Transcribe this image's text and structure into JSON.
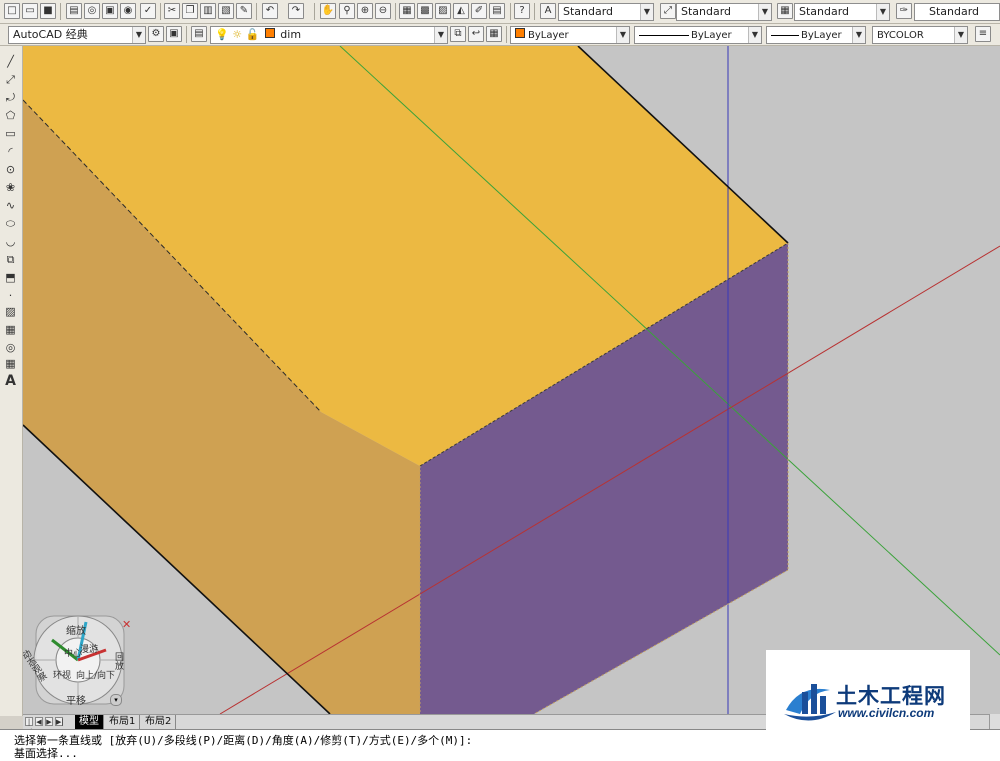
{
  "colors": {
    "top_face": "#ecb942",
    "left_face": "#cfa152",
    "front_face": "#745a8f",
    "viewport_bg": "#c5c5c5",
    "layer_swatch": "#ff7f00"
  },
  "toolbar_top": {
    "text_style": "Standard",
    "dim_style": "Standard",
    "table_style": "Standard",
    "multileader_style": "Standard"
  },
  "toolbar_props": {
    "workspace": "AutoCAD 经典",
    "layer": "dim",
    "color": "ByLayer",
    "linetype": "ByLayer",
    "lineweight": "ByLayer",
    "plotstyle": "BYCOLOR"
  },
  "left_tools": [
    "line-icon",
    "construction-line-icon",
    "polyline-icon",
    "polygon-icon",
    "rectangle-icon",
    "arc-icon",
    "circle-icon",
    "revision-cloud-icon",
    "spline-icon",
    "ellipse-icon",
    "ellipse-arc-icon",
    "insert-block-icon",
    "make-block-icon",
    "point-icon",
    "hatch-icon",
    "gradient-icon",
    "region-icon",
    "table-icon",
    "multiline-text-icon"
  ],
  "steering_wheel": {
    "zoom": "缩放",
    "orbit": "动态观察",
    "rewind": "回放",
    "pan": "平移",
    "center": "中心",
    "walk": "漫游",
    "lookup": "向上/向下",
    "look": "环视"
  },
  "tabs": [
    "模型",
    "布局1",
    "布局2"
  ],
  "command_lines": [
    "选择第一条直线或 [放弃(U)/多段线(P)/距离(D)/角度(A)/修剪(T)/方式(E)/多个(M)]:",
    "基面选择..."
  ],
  "watermark": {
    "name": "土木工程网",
    "url": "www.civilcn.com"
  }
}
